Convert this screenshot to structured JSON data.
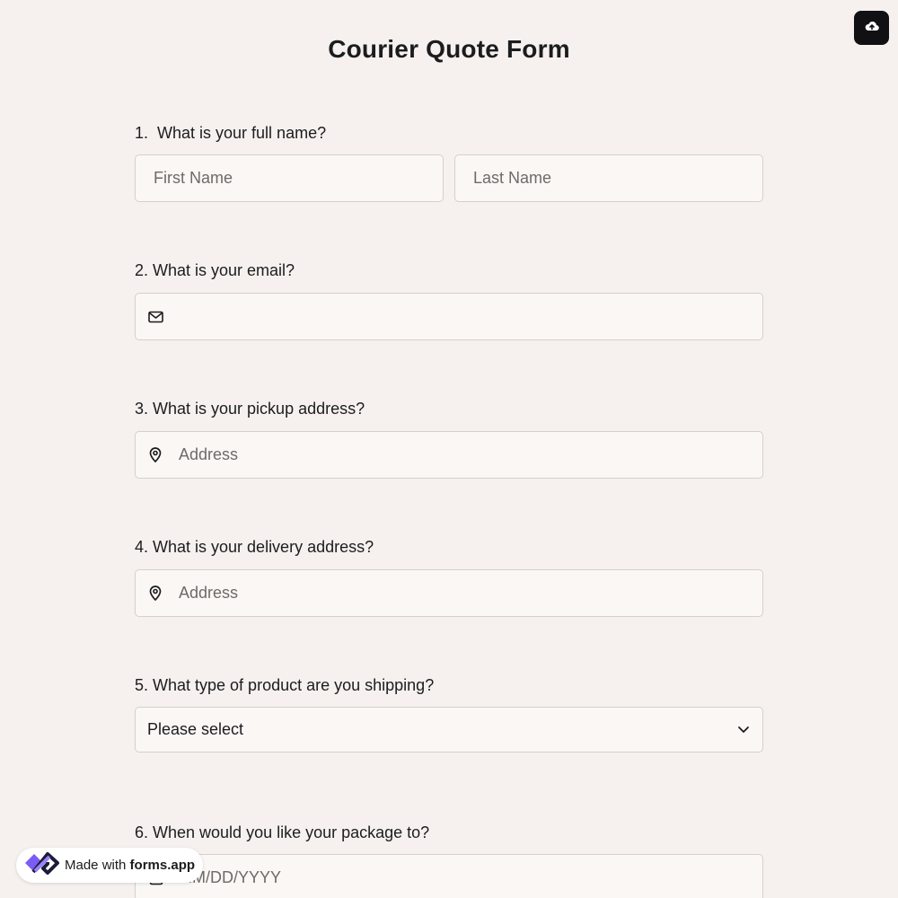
{
  "header": {
    "title": "Courier Quote Form",
    "upload_icon": "cloud-upload-icon"
  },
  "questions": [
    {
      "label": "1.  What is your full name?",
      "first_placeholder": "First Name",
      "last_placeholder": "Last Name"
    },
    {
      "label": "2. What is your email?",
      "icon": "envelope-icon",
      "value": ""
    },
    {
      "label": "3. What is your pickup address?",
      "icon": "map-pin-icon",
      "placeholder": "Address"
    },
    {
      "label": "4. What is your delivery address?",
      "icon": "map-pin-icon",
      "placeholder": "Address"
    },
    {
      "label": "5. What type of product are you shipping?",
      "selected": "Please select",
      "icon": "chevron-down-icon"
    },
    {
      "label": "6. When would you like your package to?",
      "icon": "calendar-icon",
      "placeholder": "MM/DD/YYYY"
    }
  ],
  "badge": {
    "prefix": "Made with",
    "brand": "forms.app",
    "logo": "forms-app-logo"
  },
  "colors": {
    "background": "#f6f1ef",
    "field_bg": "#faf7f5",
    "field_border": "#d6cfcc",
    "upload_button_bg": "#111114",
    "logo_purple": "#7b5cf5",
    "logo_dark": "#1b1b3a"
  }
}
